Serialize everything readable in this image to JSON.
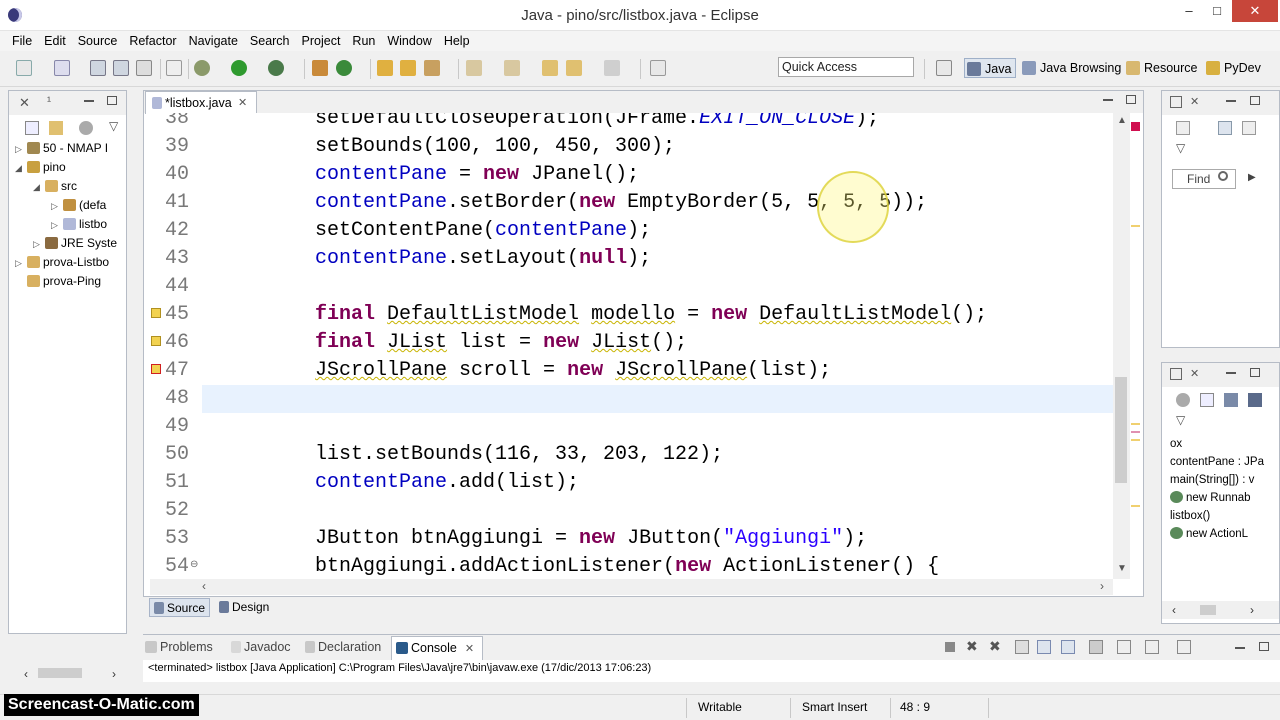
{
  "window": {
    "title": "Java - pino/src/listbox.java - Eclipse",
    "min": "–",
    "max": "□",
    "close": "✕"
  },
  "menu": [
    "File",
    "Edit",
    "Source",
    "Refactor",
    "Navigate",
    "Search",
    "Project",
    "Run",
    "Window",
    "Help"
  ],
  "quick_access": {
    "placeholder": "Quick Access"
  },
  "perspectives": [
    "Java",
    "Java Browsing",
    "Resource",
    "PyDev"
  ],
  "package_explorer": {
    "items": [
      {
        "label": "50 - NMAP I",
        "indent": 0,
        "arrow": "▷"
      },
      {
        "label": "pino",
        "indent": 0,
        "arrow": "◢"
      },
      {
        "label": "src",
        "indent": 1,
        "arrow": "◢"
      },
      {
        "label": "(defa",
        "indent": 2,
        "arrow": "▷"
      },
      {
        "label": "listbo",
        "indent": 2,
        "arrow": "▷"
      },
      {
        "label": "JRE Syste",
        "indent": 1,
        "arrow": "▷"
      },
      {
        "label": "prova-Listbo",
        "indent": 0,
        "arrow": "▷"
      },
      {
        "label": "prova-Ping",
        "indent": 0,
        "arrow": ""
      }
    ]
  },
  "editor": {
    "tab_label": "*listbox.java",
    "lines": [
      {
        "n": "38",
        "html": "setDefaultCloseOperation(JFrame.<span class=\"fld\"><i>EXIT_ON_CLOSE</i></span>);"
      },
      {
        "n": "39",
        "html": "setBounds(100, 100, 450, 300);"
      },
      {
        "n": "40",
        "html": "<span class=\"fld\">contentPane</span> = <span class=\"kw\">new</span> JPanel();"
      },
      {
        "n": "41",
        "html": "<span class=\"fld\">contentPane</span>.setBorder(<span class=\"kw\">new</span> EmptyBorder(5, 5, 5, 5));"
      },
      {
        "n": "42",
        "html": "setContentPane(<span class=\"fld\">contentPane</span>);"
      },
      {
        "n": "43",
        "html": "<span class=\"fld\">contentPane</span>.setLayout(<span class=\"kw\">null</span>);"
      },
      {
        "n": "44",
        "html": ""
      },
      {
        "n": "45",
        "html": "<span class=\"kw\">final</span> <span class=\"wv\">DefaultListModel</span> <span class=\"wv\">modello</span> = <span class=\"kw\">new</span> <span class=\"wv\">DefaultListModel</span>();"
      },
      {
        "n": "46",
        "html": "<span class=\"kw\">final</span> <span class=\"wv\">JList</span> list = <span class=\"kw\">new</span> <span class=\"wv\">JList</span>();"
      },
      {
        "n": "47",
        "html": "<span class=\"wv\">JScrollPane</span> scroll = <span class=\"kw\">new</span> <span class=\"wv\">JScrollPane</span>(list);"
      },
      {
        "n": "48",
        "html": ""
      },
      {
        "n": "49",
        "html": ""
      },
      {
        "n": "50",
        "html": "list.setBounds(116, 33, 203, 122);"
      },
      {
        "n": "51",
        "html": "<span class=\"fld\">contentPane</span>.add(list);"
      },
      {
        "n": "52",
        "html": ""
      },
      {
        "n": "53",
        "html": "JButton btnAggiungi = <span class=\"kw\">new</span> JButton(<span class=\"str\">\"Aggiungi\"</span>);"
      },
      {
        "n": "54",
        "html": "btnAggiungi.addActionListener(<span class=\"kw\">new</span> ActionListener() {"
      }
    ]
  },
  "editor_bottom_tabs": [
    "Source",
    "Design"
  ],
  "outline": {
    "find_placeholder": "Find",
    "items": [
      "ox",
      "contentPane : JPa",
      "main(String[]) : v",
      "new Runnab",
      "listbox()",
      "new ActionL"
    ]
  },
  "console": {
    "tabs": [
      "Problems",
      "Javadoc",
      "Declaration",
      "Console"
    ],
    "text": "<terminated> listbox [Java Application] C:\\Program Files\\Java\\jre7\\bin\\javaw.exe (17/dic/2013 17:06:23)"
  },
  "status": {
    "writable": "Writable",
    "insert": "Smart Insert",
    "position": "48 : 9"
  },
  "watermark": "Screencast-O-Matic.com"
}
